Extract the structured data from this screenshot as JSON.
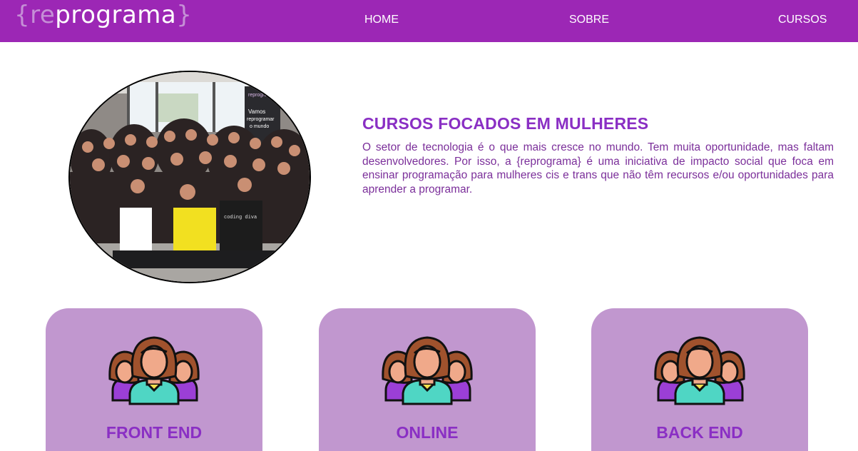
{
  "navbar": {
    "logo": {
      "open_brace": "{",
      "re": "re",
      "name": "programa",
      "close_brace": "}"
    },
    "links": [
      {
        "label": "HOME"
      },
      {
        "label": "SOBRE"
      },
      {
        "label": "CURSOS"
      }
    ],
    "background": "#9c27b5"
  },
  "hero": {
    "title": "CURSOS FOCADOS EM MULHERES",
    "text": "O setor de tecnologia é o que mais cresce no mundo. Tem muita oportunidade, mas faltam desenvolvedores. Por isso, a {reprograma} é uma iniciativa de impacto social que foca em ensinar programação para mulheres cis e trans que não têm recursos e/ou oportunidades para aprender a programar.",
    "photo_sign": {
      "brand": "reprograma",
      "line1": "Vamos",
      "line2": "reprogramar",
      "line3": "o mundo"
    },
    "shirt_text": "coding diva"
  },
  "cards": [
    {
      "label": "FRONT END",
      "icon": "women-group-icon"
    },
    {
      "label": "ONLINE",
      "icon": "women-group-icon"
    },
    {
      "label": "BACK END",
      "icon": "women-group-icon"
    }
  ],
  "colors": {
    "accent": "#8a2fc4",
    "text": "#7b2f9a",
    "card": "#c197cf"
  }
}
